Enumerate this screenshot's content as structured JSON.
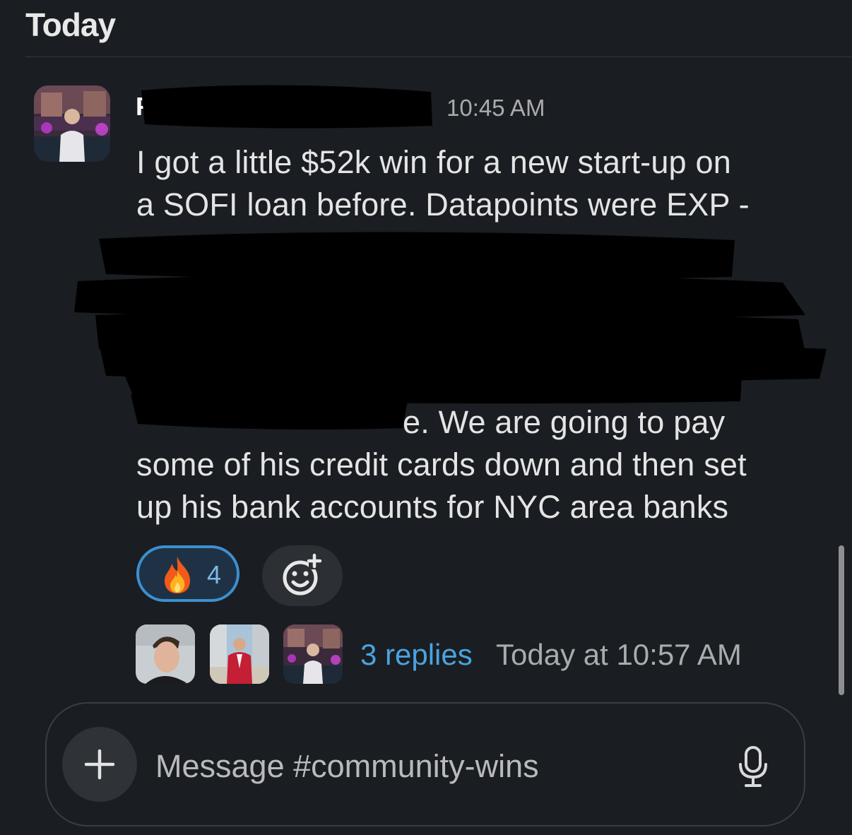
{
  "header": {
    "day_label": "Today"
  },
  "message": {
    "sender_visible": "F",
    "timestamp": "10:45 AM",
    "lines": [
      "I got a little $52k win for a new start-up on",
      "a SOFI loan before. Datapoints were EXP -",
      "e. We are going to pay",
      "some of his credit cards down and then set",
      "up his bank accounts for NYC area banks"
    ],
    "reaction": {
      "emoji": "fire-emoji",
      "count": "4"
    }
  },
  "thread": {
    "replies_label": "3 replies",
    "last_reply_time": "Today at 10:57 AM"
  },
  "composer": {
    "placeholder": "Message #community-wins"
  },
  "colors": {
    "background": "#1a1d21",
    "link": "#4aa3df",
    "reaction_border": "#3d8fd0",
    "muted_text": "#a9abad"
  }
}
